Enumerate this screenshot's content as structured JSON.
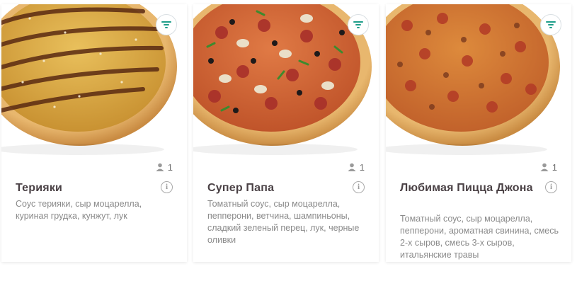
{
  "colors": {
    "accent": "#1f9e8a",
    "title": "#4a4145",
    "description": "#8a8a8a",
    "card_background": "#ffffff"
  },
  "icons": {
    "filter": "filter-lines-icon",
    "person": "person-icon",
    "info": "info-icon"
  },
  "pizzas": [
    {
      "name": "Терияки",
      "persons": "1",
      "description": "Соус терияки, сыр моцарелла, куриная грудка, кунжут, лук",
      "info_label": "i"
    },
    {
      "name": "Супер Папа",
      "persons": "1",
      "description": "Томатный соус, сыр моцарелла, пепперони, ветчина, шампиньоны, сладкий зеленый перец, лук, черные оливки",
      "info_label": "i"
    },
    {
      "name": "Любимая Пицца Джона",
      "persons": "1",
      "description": "Томатный соус, сыр моцарелла, пепперони, ароматная свинина, смесь 2-х сыров, смесь 3-х сыров, итальянские травы",
      "info_label": "i"
    }
  ]
}
